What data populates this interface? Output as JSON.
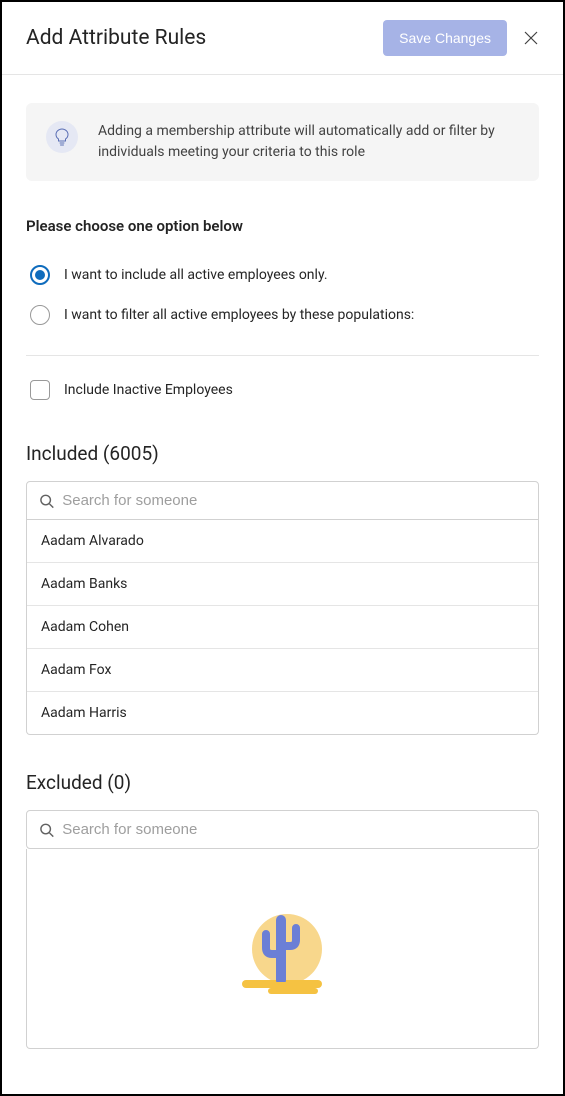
{
  "header": {
    "title": "Add Attribute Rules",
    "save_label": "Save Changes"
  },
  "info": {
    "text": "Adding a membership attribute will automatically add or filter by individuals meeting your criteria to this role"
  },
  "options": {
    "section_label": "Please choose one option below",
    "option1": "I want to include all active employees only.",
    "option2": "I want to filter all active employees by these populations:",
    "checkbox_label": "Include Inactive Employees"
  },
  "included": {
    "title": "Included (6005)",
    "search_placeholder": "Search for someone",
    "items": [
      "Aadam Alvarado",
      "Aadam Banks",
      "Aadam Cohen",
      "Aadam Fox",
      "Aadam Harris"
    ]
  },
  "excluded": {
    "title": "Excluded (0)",
    "search_placeholder": "Search for someone"
  }
}
